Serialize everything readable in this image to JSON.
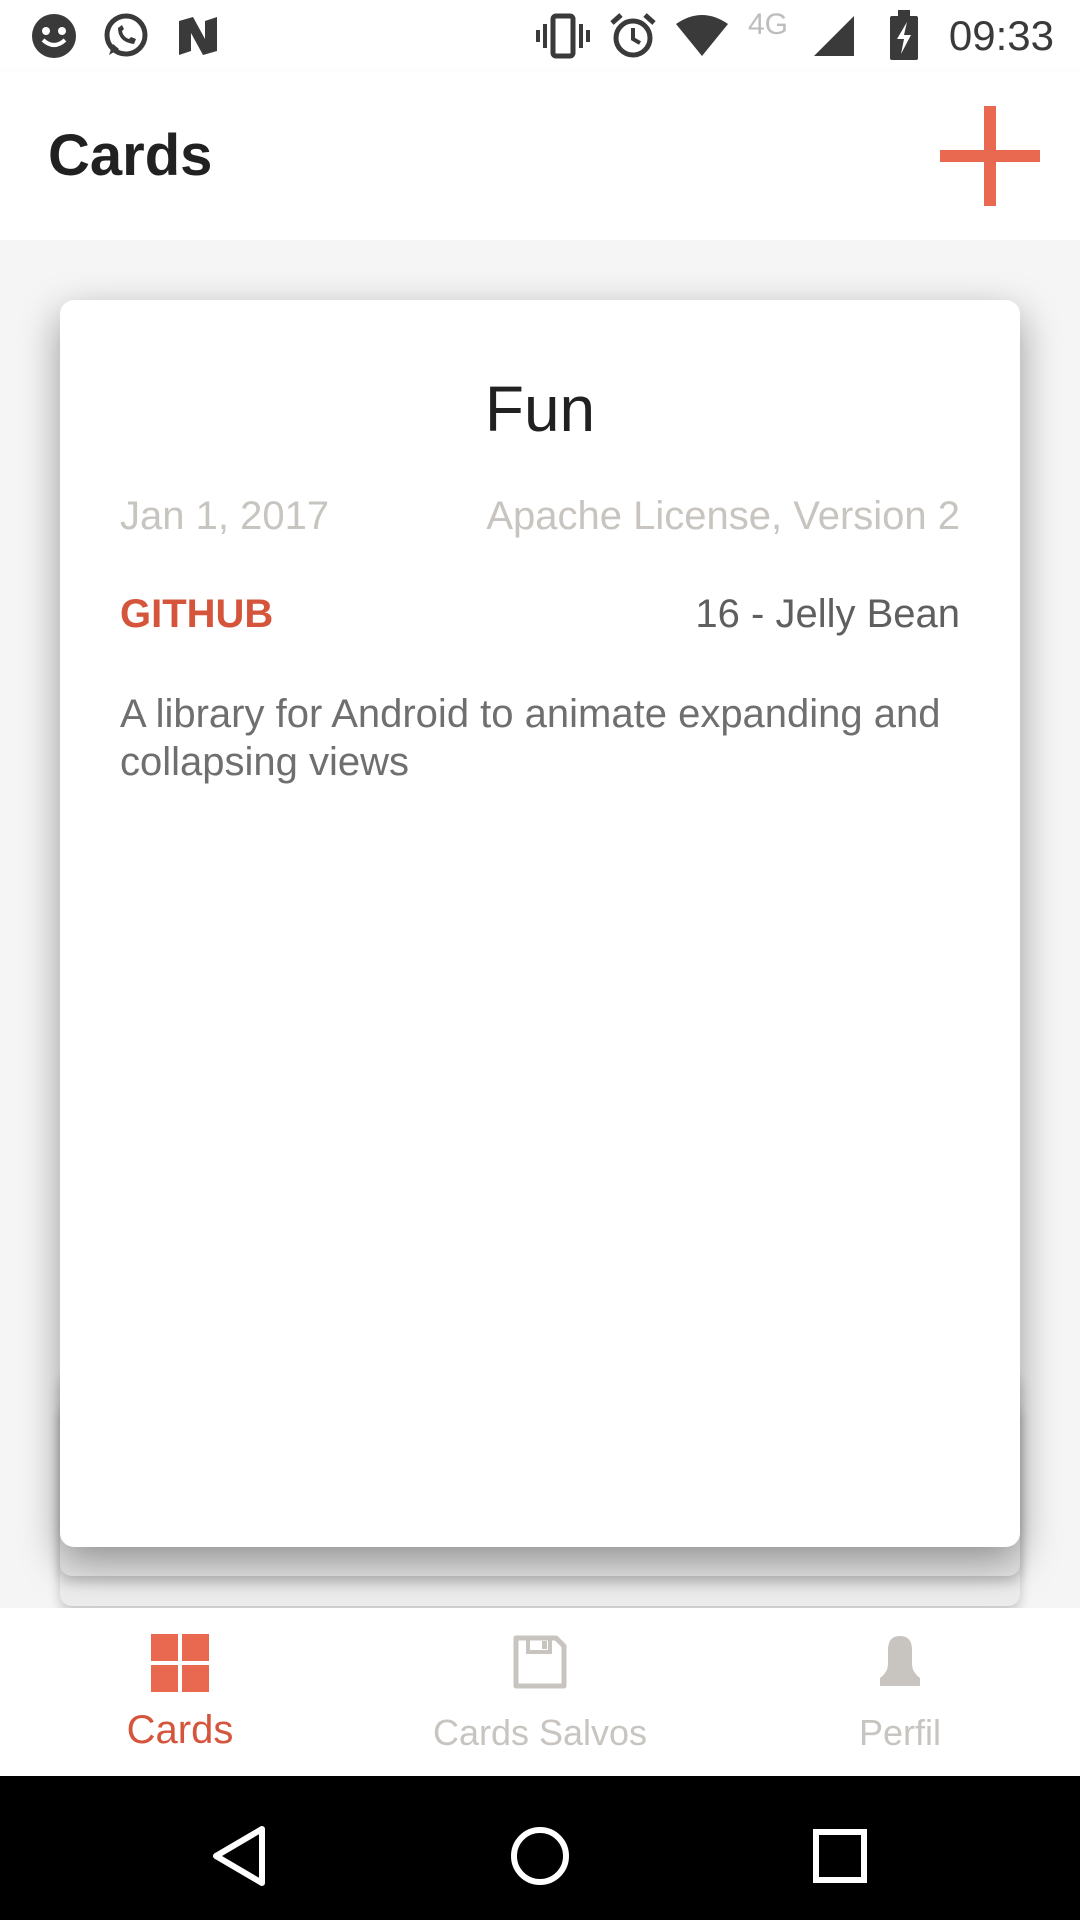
{
  "status_bar": {
    "time": "09:33",
    "network": "4G",
    "icons": [
      "smiley-icon",
      "whatsapp-icon",
      "n-app-icon",
      "vibrate-icon",
      "alarm-icon",
      "wifi-icon",
      "cell-signal-icon",
      "battery-charging-icon"
    ]
  },
  "toolbar": {
    "title": "Cards",
    "add_icon": "plus-icon"
  },
  "card": {
    "title": "Fun",
    "date": "Jan 1, 2017",
    "license": "Apache License, Version 2",
    "link_label": "GITHUB",
    "min_api": "16 - Jelly Bean",
    "description": "A library for Android to animate expanding and collapsing views"
  },
  "bottom_nav": {
    "items": [
      {
        "label": "Cards",
        "icon": "grid-icon",
        "active": true
      },
      {
        "label": "Cards Salvos",
        "icon": "floppy-disk-icon",
        "active": false
      },
      {
        "label": "Perfil",
        "icon": "person-icon",
        "active": false
      }
    ]
  },
  "colors": {
    "accent": "#e8694f",
    "accent_text": "#d4553b",
    "inactive": "#c8c4bf"
  },
  "system_nav": {
    "icons": [
      "back-icon",
      "home-icon",
      "recents-icon"
    ]
  }
}
